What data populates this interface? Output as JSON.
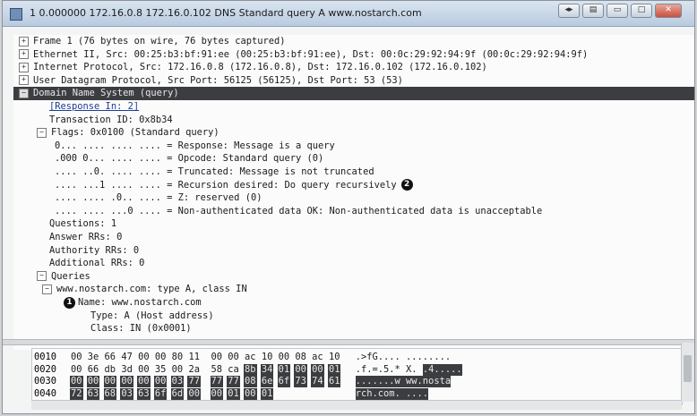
{
  "window": {
    "title": "1 0.000000 172.16.0.8 172.16.0.102 DNS Standard query A www.nostarch.com",
    "buttons": [
      "◂▸",
      "▤",
      "▭",
      "□",
      "✕"
    ]
  },
  "tree": [
    {
      "text": "Frame 1 (76 bytes on wire, 76 bytes captured)",
      "expander": "+",
      "indent": 0
    },
    {
      "text": "Ethernet II, Src: 00:25:b3:bf:91:ee (00:25:b3:bf:91:ee), Dst: 00:0c:29:92:94:9f (00:0c:29:92:94:9f)",
      "expander": "+",
      "indent": 0
    },
    {
      "text": "Internet Protocol, Src: 172.16.0.8 (172.16.0.8), Dst: 172.16.0.102 (172.16.0.102)",
      "expander": "+",
      "indent": 0
    },
    {
      "text": "User Datagram Protocol, Src Port: 56125 (56125), Dst Port: 53 (53)",
      "expander": "+",
      "indent": 0
    },
    {
      "text": "Domain Name System (query)",
      "expander": "−",
      "indent": 0,
      "selected": true
    },
    {
      "text": "[Response In: 2]",
      "indent": 1,
      "link": true
    },
    {
      "text": "Transaction ID: 0x8b34",
      "indent": 1
    },
    {
      "text": "Flags: 0x0100 (Standard query)",
      "expander": "−",
      "indent": 1
    },
    {
      "text": "0... .... .... .... = Response: Message is a query",
      "indent": 2
    },
    {
      "text": ".000 0... .... .... = Opcode: Standard query (0)",
      "indent": 2
    },
    {
      "text": ".... ..0. .... .... = Truncated: Message is not truncated",
      "indent": 2
    },
    {
      "text": ".... ...1 .... .... = Recursion desired: Do query recursively",
      "indent": 2,
      "callout": "2"
    },
    {
      "text": ".... .... .0.. .... = Z: reserved (0)",
      "indent": 2
    },
    {
      "text": ".... .... ...0 .... = Non-authenticated data OK: Non-authenticated data is unacceptable",
      "indent": 2
    },
    {
      "text": "Questions: 1",
      "indent": 1
    },
    {
      "text": "Answer RRs: 0",
      "indent": 1
    },
    {
      "text": "Authority RRs: 0",
      "indent": 1
    },
    {
      "text": "Additional RRs: 0",
      "indent": 1
    },
    {
      "text": "Queries",
      "expander": "−",
      "indent": 1
    },
    {
      "text": "www.nostarch.com: type A, class IN",
      "expander": "−",
      "indent": 2
    },
    {
      "text": "Name: www.nostarch.com",
      "indent": 3,
      "callout_before": "1"
    },
    {
      "text": "Type: A (Host address)",
      "indent": 3
    },
    {
      "text": "Class: IN (0x0001)",
      "indent": 3
    }
  ],
  "hex_dump": [
    {
      "offset": "0010",
      "bytes": [
        "00",
        "3e",
        "66",
        "47",
        "00",
        "00",
        "80",
        "11",
        "00",
        "00",
        "ac",
        "10",
        "00",
        "08",
        "ac",
        "10"
      ],
      "hl_from": 99,
      "ascii": ".>fG.... ........",
      "ascii_hl": ""
    },
    {
      "offset": "0020",
      "bytes": [
        "00",
        "66",
        "db",
        "3d",
        "00",
        "35",
        "00",
        "2a",
        "58",
        "ca",
        "8b",
        "34",
        "01",
        "00",
        "00",
        "01"
      ],
      "hl_from": 10,
      "ascii": ".f.=.5.* X.",
      "ascii_hl": ".4....."
    },
    {
      "offset": "0030",
      "bytes": [
        "00",
        "00",
        "00",
        "00",
        "00",
        "00",
        "03",
        "77",
        "77",
        "77",
        "08",
        "6e",
        "6f",
        "73",
        "74",
        "61"
      ],
      "hl_from": 0,
      "ascii": "",
      "ascii_hl": ".......w ww.nosta"
    },
    {
      "offset": "0040",
      "bytes": [
        "72",
        "63",
        "68",
        "03",
        "63",
        "6f",
        "6d",
        "00",
        "00",
        "01",
        "00",
        "01"
      ],
      "hl_from": 0,
      "ascii": "",
      "ascii_hl": "rch.com. ...."
    }
  ],
  "colors": {
    "selection": "#3b3d40",
    "title_gradient_top": "#d9e4ef"
  }
}
